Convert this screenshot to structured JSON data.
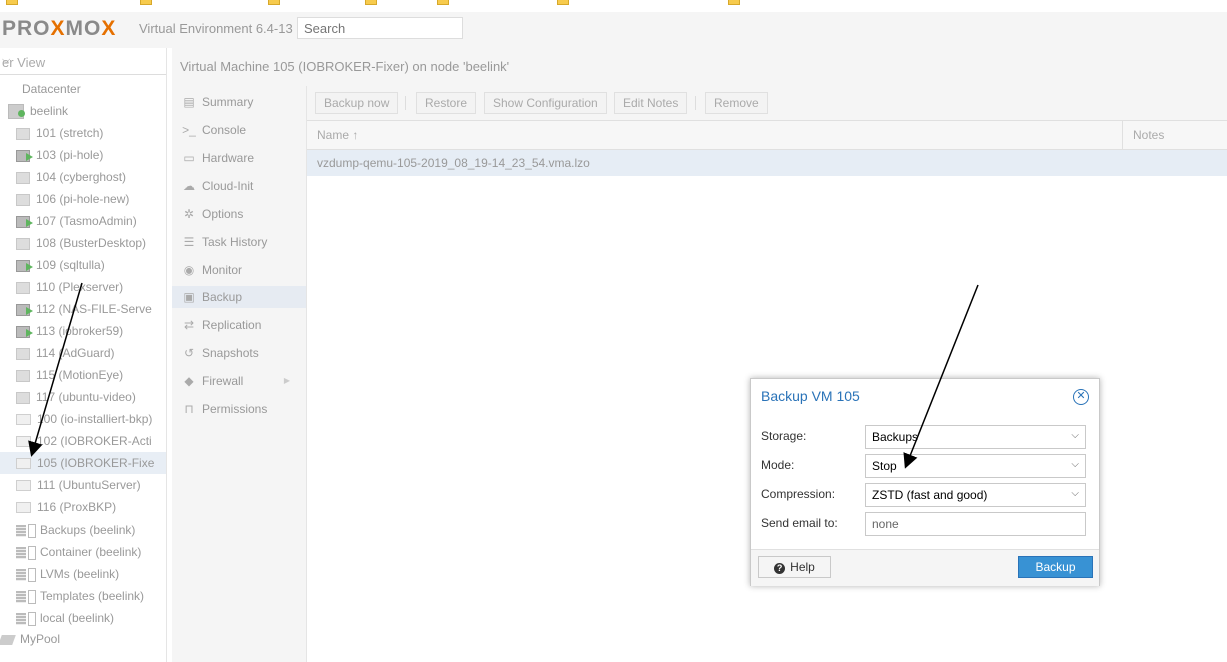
{
  "header": {
    "logo_left": "PRO",
    "logo_x": "X",
    "logo_mid": "MO",
    "logo_x2": "X",
    "version": "Virtual Environment 6.4-13",
    "search_placeholder": "Search"
  },
  "tree": {
    "view_label": "er View",
    "items": [
      {
        "label": "Datacenter",
        "icon": "datacenter-icon"
      },
      {
        "label": "beelink",
        "icon": "server-icon"
      },
      {
        "label": "101 (stretch)",
        "icon": "vm-icon"
      },
      {
        "label": "103 (pi-hole)",
        "icon": "running-vm-icon"
      },
      {
        "label": "104 (cyberghost)",
        "icon": "vm-icon"
      },
      {
        "label": "106 (pi-hole-new)",
        "icon": "vm-icon"
      },
      {
        "label": "107 (TasmoAdmin)",
        "icon": "running-vm-icon"
      },
      {
        "label": "108 (BusterDesktop)",
        "icon": "vm-icon"
      },
      {
        "label": "109 (sqltulla)",
        "icon": "running-vm-icon"
      },
      {
        "label": "110 (Plexserver)",
        "icon": "vm-icon"
      },
      {
        "label": "112 (NAS-FILE-Serve",
        "icon": "running-vm-icon"
      },
      {
        "label": "113 (iobroker59)",
        "icon": "running-vm-icon"
      },
      {
        "label": "114 (AdGuard)",
        "icon": "vm-icon"
      },
      {
        "label": "115 (MotionEye)",
        "icon": "vm-icon"
      },
      {
        "label": "117 (ubuntu-video)",
        "icon": "vm-icon"
      },
      {
        "label": "100 (io-installiert-bkp)",
        "icon": "monitor-icon"
      },
      {
        "label": "102 (IOBROKER-Acti",
        "icon": "monitor-icon"
      },
      {
        "label": "105 (IOBROKER-Fixe",
        "icon": "monitor-icon"
      },
      {
        "label": "111 (UbuntuServer)",
        "icon": "monitor-icon"
      },
      {
        "label": "116 (ProxBKP)",
        "icon": "monitor-icon"
      },
      {
        "label": "Backups (beelink)",
        "icon": "storage-icon"
      },
      {
        "label": "Container (beelink)",
        "icon": "storage-icon"
      },
      {
        "label": "LVMs (beelink)",
        "icon": "storage-icon"
      },
      {
        "label": "Templates (beelink)",
        "icon": "storage-icon"
      },
      {
        "label": "local (beelink)",
        "icon": "storage-icon"
      },
      {
        "label": "MyPool",
        "icon": "tags-icon"
      }
    ]
  },
  "vm_title": "Virtual Machine 105 (IOBROKER-Fixer) on node 'beelink'",
  "nav": {
    "items": [
      {
        "label": "Summary",
        "icon": "book-icon",
        "glyph": "▤"
      },
      {
        "label": "Console",
        "icon": "terminal-icon",
        "glyph": ">_"
      },
      {
        "label": "Hardware",
        "icon": "desktop-icon",
        "glyph": "▭"
      },
      {
        "label": "Cloud-Init",
        "icon": "cloud-icon",
        "glyph": "☁"
      },
      {
        "label": "Options",
        "icon": "gear-icon",
        "glyph": "✲"
      },
      {
        "label": "Task History",
        "icon": "list-icon",
        "glyph": "☰"
      },
      {
        "label": "Monitor",
        "icon": "eye-icon",
        "glyph": "◉"
      },
      {
        "label": "Backup",
        "icon": "floppy-icon",
        "glyph": "▣"
      },
      {
        "label": "Replication",
        "icon": "retweet-icon",
        "glyph": "⇄"
      },
      {
        "label": "Snapshots",
        "icon": "history-icon",
        "glyph": "↺"
      },
      {
        "label": "Firewall",
        "icon": "shield-icon",
        "glyph": "◆"
      },
      {
        "label": "Permissions",
        "icon": "unlock-icon",
        "glyph": "⊓"
      }
    ]
  },
  "toolbar": {
    "backup_now": "Backup now",
    "restore": "Restore",
    "show_configuration": "Show Configuration",
    "edit_notes": "Edit Notes",
    "remove": "Remove"
  },
  "grid": {
    "col_name": "Name ↑",
    "col_notes": "Notes",
    "rows": [
      "vzdump-qemu-105-2019_08_19-14_23_54.vma.lzo"
    ]
  },
  "dialog": {
    "title": "Backup VM 105",
    "storage_label": "Storage:",
    "storage_value": "Backups",
    "mode_label": "Mode:",
    "mode_value": "Stop",
    "compression_label": "Compression:",
    "compression_value": "ZSTD (fast and good)",
    "email_label": "Send email to:",
    "email_placeholder": "none",
    "help_label": "Help",
    "backup_label": "Backup"
  },
  "colors": {
    "accent": "#3892d4",
    "dialog_title": "#2a73b8",
    "logo_orange": "#e57000",
    "running_green": "#5fb55f"
  }
}
